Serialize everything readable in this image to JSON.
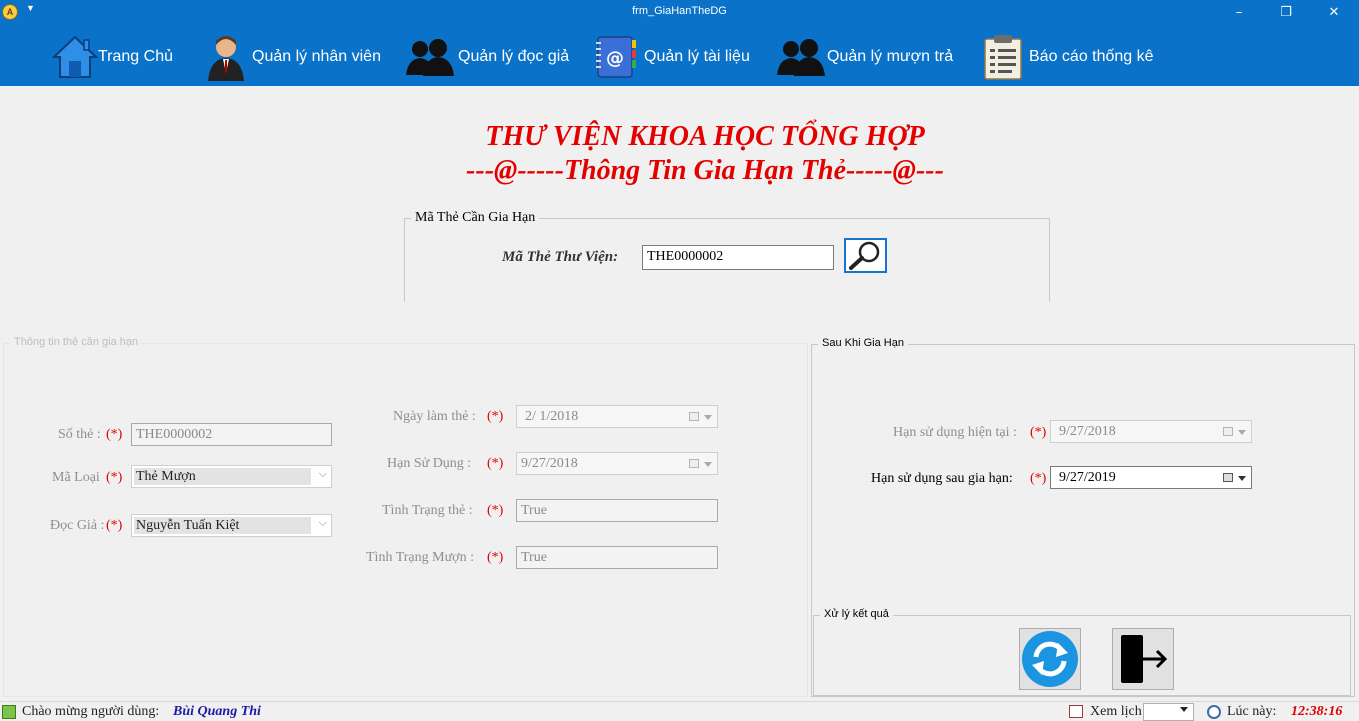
{
  "window": {
    "title": "frm_GiaHanTheDG"
  },
  "menu": {
    "items": [
      {
        "label": "Trang Chủ"
      },
      {
        "label": "Quản lý nhân viên"
      },
      {
        "label": "Quản lý đọc giả"
      },
      {
        "label": "Quản lý tài liệu"
      },
      {
        "label": "Quản lý mượn trả"
      },
      {
        "label": "Báo cáo thống kê"
      }
    ]
  },
  "header": {
    "title": "THƯ VIỆN KHOA HỌC TỔNG HỢP",
    "subtitle": "---@-----Thông Tin Gia Hạn Thẻ-----@---"
  },
  "search_group": {
    "title": "Mã Thẻ Cần Gia Hạn",
    "label": "Mã Thẻ Thư Viện:",
    "value": "THE0000002"
  },
  "info_group": {
    "title": "Thông tin thẻ cần gia hạn",
    "required_mark": "(*)",
    "card_no_label": "Số thẻ  :",
    "card_no": "THE0000002",
    "type_label": "Mã Loại",
    "type_value": "Thẻ Mượn",
    "reader_label": "Đọc Giả  :",
    "reader_value": "Nguyễn Tuấn Kiệt",
    "created_label": "Ngày làm thẻ :",
    "created_value": "2/  1/2018",
    "expiry_label": "Hạn Sử Dụng :",
    "expiry_value": "9/27/2018",
    "card_status_label": "Tình Trạng thẻ :",
    "card_status_value": "True",
    "borrow_status_label": "Tình Trạng Mượn :",
    "borrow_status_value": "True"
  },
  "after_group": {
    "title": "Sau Khi Gia Hạn",
    "current_label": "Hạn sử dụng hiện tại :",
    "current_value": "9/27/2018",
    "new_label": "Hạn sử dụng sau gia hạn:",
    "new_value": "9/27/2019"
  },
  "result_group": {
    "title": "Xử lý kết quả"
  },
  "statusbar": {
    "welcome_label": "Chào mừng người dùng:",
    "user": "Bùi Quang Thi",
    "calendar_label": "Xem lịch",
    "time_label": "Lúc này:",
    "time": "12:38:16"
  },
  "icons": {
    "app": "app-logo-icon",
    "home": "home-icon",
    "staff": "employee-icon",
    "readers": "readers-icon",
    "docs": "address-book-icon",
    "borrow": "people-icon",
    "report": "report-icon",
    "search": "magnifier-icon",
    "refresh": "refresh-icon",
    "exit": "exit-icon"
  },
  "colors": {
    "menu_bg": "#0a72c8",
    "accent_red": "#e50000",
    "user_blue": "#1a1aa8"
  }
}
